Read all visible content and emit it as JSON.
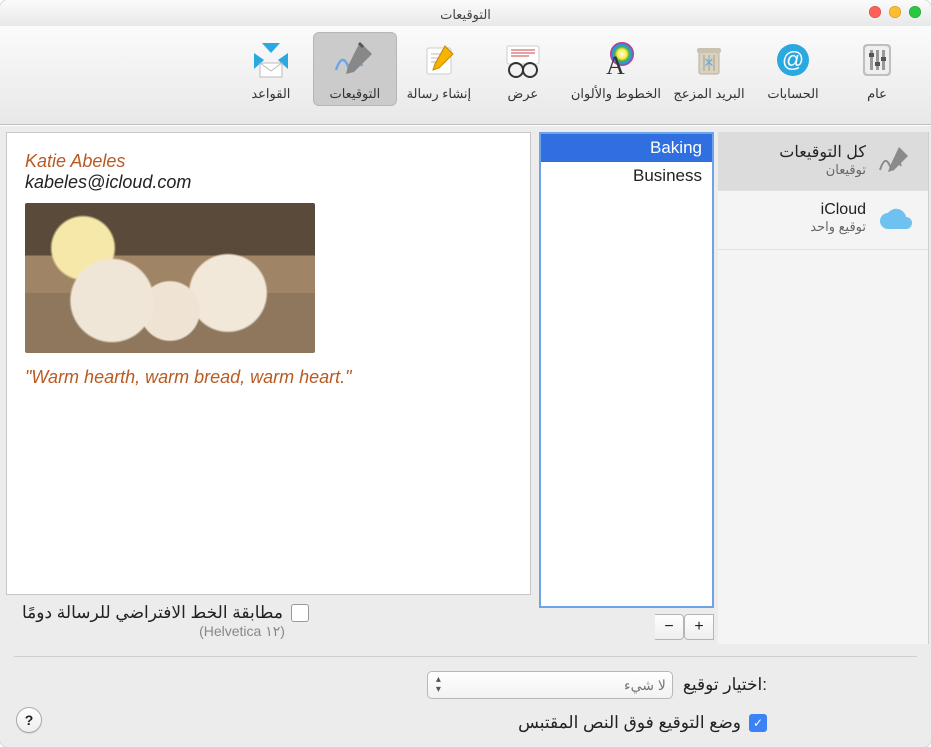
{
  "window": {
    "title": "التوقيعات"
  },
  "toolbar": {
    "items": [
      {
        "key": "general",
        "label": "عام"
      },
      {
        "key": "accounts",
        "label": "الحسابات"
      },
      {
        "key": "junk",
        "label": "البريد المزعج"
      },
      {
        "key": "fonts",
        "label": "الخطوط والألوان"
      },
      {
        "key": "viewing",
        "label": "عرض"
      },
      {
        "key": "compose",
        "label": "إنشاء رسالة"
      },
      {
        "key": "signatures",
        "label": "التوقيعات",
        "selected": true
      },
      {
        "key": "rules",
        "label": "القواعد"
      }
    ]
  },
  "sidebar": {
    "items": [
      {
        "name": "كل التوقيعات",
        "count": "توقيعان",
        "icon": "signature",
        "selected": true
      },
      {
        "name": "iCloud",
        "count": "توقيع واحد",
        "icon": "icloud"
      }
    ]
  },
  "signatures": {
    "items": [
      {
        "name": "Baking",
        "selected": true
      },
      {
        "name": "Business"
      }
    ],
    "add_label": "+",
    "remove_label": "−"
  },
  "preview": {
    "name": "Katie Abeles",
    "email": "kabeles@icloud.com",
    "quote": "\"Warm hearth, warm bread, warm heart.\""
  },
  "options": {
    "match_font_label": "مطابقة الخط الافتراضي للرسالة دومًا",
    "match_font_note": "(Helvetica ١٢)",
    "choose_signature_label": "اختيار توقيع:",
    "choose_signature_value": "لا شيء",
    "place_above_label": "وضع التوقيع فوق النص المقتبس",
    "place_above_checked": true,
    "match_font_checked": false
  },
  "help_label": "?"
}
